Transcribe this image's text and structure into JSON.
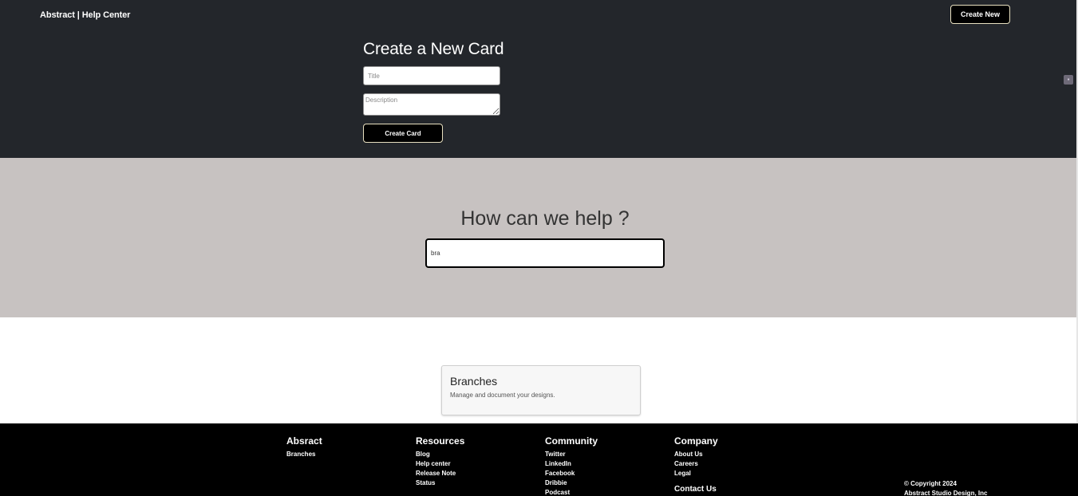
{
  "header": {
    "brand": "Abstract | Help Center",
    "create_new_label": "Create New"
  },
  "form": {
    "title": "Create a New Card",
    "title_placeholder": "Title",
    "description_placeholder": "Description",
    "submit_label": "Create Card"
  },
  "hero": {
    "title": "How can we help ?",
    "search_value": "bra"
  },
  "results": [
    {
      "title": "Branches",
      "description": "Manage and document your designs."
    }
  ],
  "footer": {
    "columns": [
      {
        "title": "Absract",
        "links": [
          "Branches"
        ]
      },
      {
        "title": "Resources",
        "links": [
          "Blog",
          "Help center",
          "Release Note",
          "Status"
        ]
      },
      {
        "title": "Community",
        "links": [
          "Twitter",
          "LinkedIn",
          "Facebook",
          "Dribbie",
          "Podcast"
        ]
      },
      {
        "title": "Company",
        "links": [
          "About Us",
          "Careers",
          "Legal"
        ]
      }
    ],
    "contact": "Contact Us",
    "copyright_line1": "© Copyright 2024",
    "copyright_line2": "Abstract Studio Design, Inc"
  },
  "colors": {
    "header_bg": "#23262b",
    "hero_bg": "#c7c2c1",
    "footer_bg": "#000000",
    "button_border": "#e8e0c0"
  },
  "icons": {
    "side_icon": "chat-bubble-icon"
  }
}
